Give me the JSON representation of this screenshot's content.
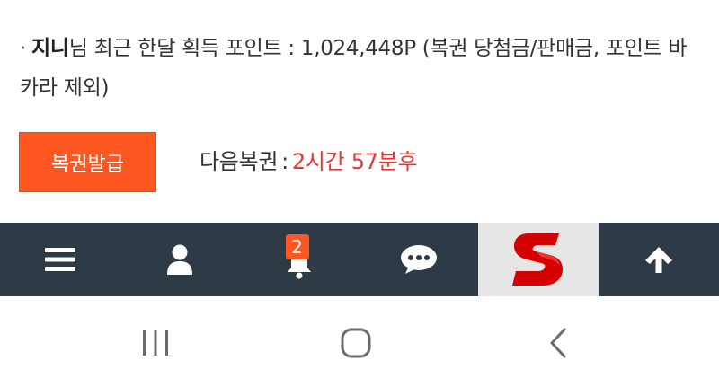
{
  "points_info": {
    "bullet": "·",
    "user_name": "지니",
    "text": "님 최근 한달 획득 포인트 : 1,024,448P (복권 당첨금/판매금, 포인트 바카라 제외)"
  },
  "ticket": {
    "issue_button_label": "복권발급",
    "next_label": "다음복권",
    "separator": ":",
    "next_time": "2시간 57분후"
  },
  "toolbar": {
    "items": [
      {
        "icon": "menu-icon"
      },
      {
        "icon": "user-icon"
      },
      {
        "icon": "bell-icon",
        "badge": "2"
      },
      {
        "icon": "chat-icon"
      },
      {
        "icon": "site-logo"
      },
      {
        "icon": "arrow-up-icon"
      }
    ]
  },
  "colors": {
    "accent": "#ff5722",
    "time_red": "#e53935",
    "toolbar_bg": "#2e3a46",
    "logo_red": "#d50000"
  },
  "navbar": {
    "items": [
      {
        "icon": "recent-apps-icon"
      },
      {
        "icon": "home-icon"
      },
      {
        "icon": "back-icon"
      }
    ]
  }
}
